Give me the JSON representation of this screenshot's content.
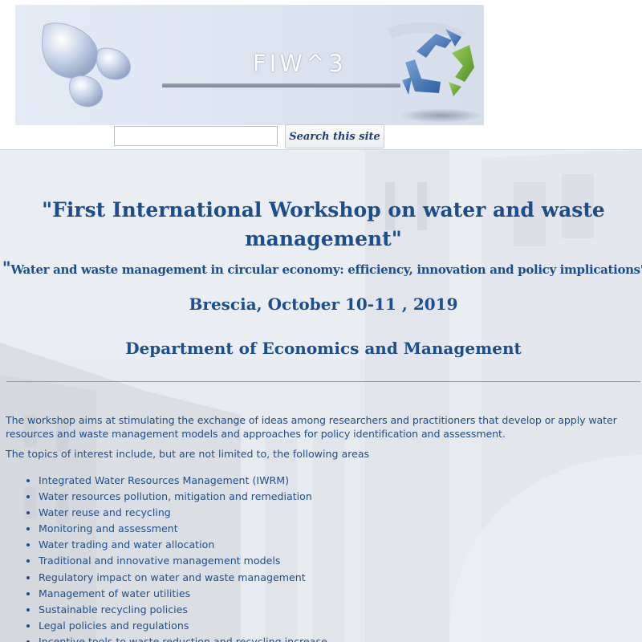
{
  "header": {
    "logo_text": "FIW^3",
    "search": {
      "placeholder": "",
      "value": "",
      "button_label": "Search this site"
    }
  },
  "main": {
    "title": "\"First International Workshop on water and waste management\"",
    "subtitle_quote_open": "\"",
    "subtitle": "Water and waste management in circular economy: efficiency, innovation and policy implications\"",
    "location_date": "Brescia, October 10-11 , 2019",
    "department": "Department of Economics and Management",
    "intro": "The workshop aims at stimulating the exchange of ideas among researchers and practitioners that develop or apply water resources and waste management models and approaches for policy identification and assessment.",
    "topics_intro": "The topics of interest include, but are not limited to, the following areas",
    "topics": [
      "Integrated Water Resources Management (IWRM)",
      "Water resources pollution, mitigation and remediation",
      "Water reuse and recycling",
      "Monitoring and assessment",
      "Water trading and water allocation",
      "Traditional and innovative management models",
      "Regulatory impact on water and waste management",
      "Management of water utilities",
      "Sustainable recycling policies",
      "Legal policies and regulations",
      "Incentive tools to waste reduction and recycling increase"
    ]
  },
  "colors": {
    "heading": "#1c4d8c",
    "body_text": "#1f4e8a",
    "banner_background": "#dde5f1",
    "recycle_blue": "#3f6fb0",
    "recycle_green": "#6fae3c"
  },
  "icons": {
    "logo_drops": "water-drops-icon",
    "logo_recycle": "recycle-icon"
  }
}
